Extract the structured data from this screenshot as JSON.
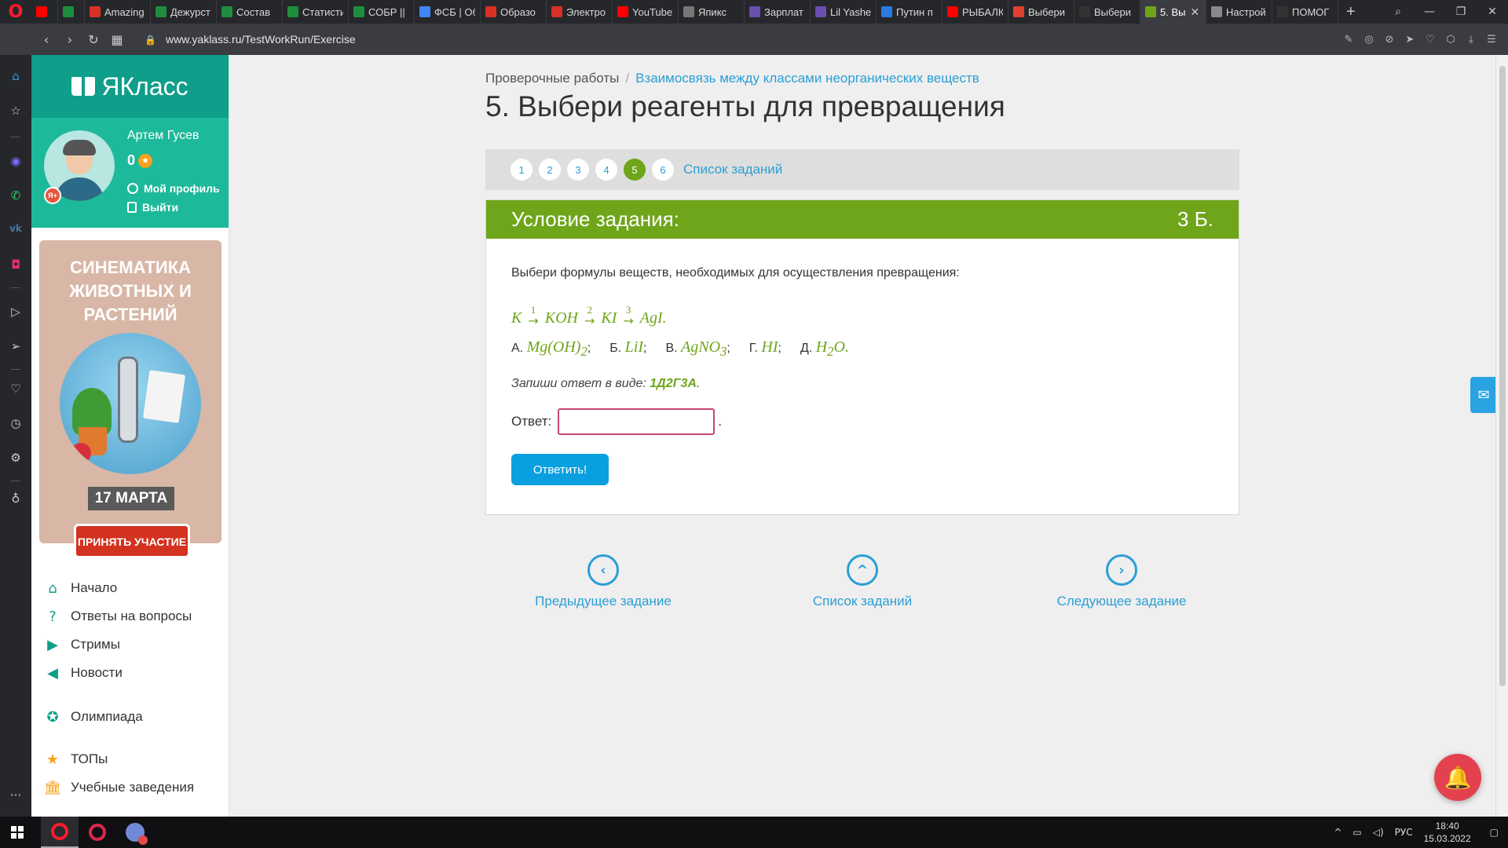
{
  "browser": {
    "tabs": [
      {
        "title": "",
        "color": "#ff0000",
        "icon": "youtube-icon"
      },
      {
        "title": "",
        "color": "#1e8e3e",
        "icon": "sheets-icon"
      },
      {
        "title": "Amazing",
        "color": "#d93025",
        "icon": "adobe-icon"
      },
      {
        "title": "Дежурст",
        "color": "#1e8e3e",
        "icon": "sheets-icon"
      },
      {
        "title": "Состав",
        "color": "#1e8e3e",
        "icon": "sheets-icon"
      },
      {
        "title": "Статисти",
        "color": "#1e8e3e",
        "icon": "sheets-icon"
      },
      {
        "title": "СОБР ||",
        "color": "#1e8e3e",
        "icon": "sheets-icon"
      },
      {
        "title": "ФСБ | Об",
        "color": "#4285f4",
        "icon": "docs-icon"
      },
      {
        "title": "Образо",
        "color": "#d93025",
        "icon": "doc-red-icon"
      },
      {
        "title": "Электро",
        "color": "#d93025",
        "icon": "doc-red-icon"
      },
      {
        "title": "YouTube",
        "color": "#ff0000",
        "icon": "youtube-icon"
      },
      {
        "title": "Япикс",
        "color": "#777777",
        "icon": "yapiks-icon"
      },
      {
        "title": "Зарплат",
        "color": "#6a4fb0",
        "icon": "list-icon"
      },
      {
        "title": "Lil Yasher",
        "color": "#6a4fb0",
        "icon": "list-icon"
      },
      {
        "title": "Путин п",
        "color": "#2a7ae2",
        "icon": "globe-icon"
      },
      {
        "title": "РЫБАЛК",
        "color": "#ff0000",
        "icon": "youtube-icon"
      },
      {
        "title": "Выбери",
        "color": "#e04030",
        "icon": "yandex-icon"
      },
      {
        "title": "Выбери",
        "color": "#333333",
        "icon": "yaklass-icon"
      },
      {
        "title": "5. Вы",
        "color": "#6fa51a",
        "icon": "yaklass-book-icon",
        "active": true
      },
      {
        "title": "Настрой",
        "color": "#888888",
        "icon": "gear-icon"
      },
      {
        "title": "ПОМОГ",
        "color": "#333333",
        "icon": "yaklass-icon"
      }
    ],
    "url": "www.yaklass.ru/TestWorkRun/Exercise"
  },
  "site": {
    "logo": "ЯКласс",
    "user": {
      "name": "Артем Гусев",
      "score": "0",
      "profile_link": "Мой профиль",
      "logout_link": "Выйти"
    },
    "banner": {
      "title": "СИНЕМАТИКА ЖИВОТНЫХ И РАСТЕНИЙ",
      "date": "17 МАРТА",
      "cta": "ПРИНЯТЬ УЧАСТИЕ"
    },
    "menu": [
      {
        "label": "Начало",
        "icon": "home-icon",
        "color": "#0e9e8a"
      },
      {
        "label": "Ответы на вопросы",
        "icon": "question-icon",
        "color": "#0e9e8a"
      },
      {
        "label": "Стримы",
        "icon": "play-icon",
        "color": "#0e9e8a"
      },
      {
        "label": "Новости",
        "icon": "megaphone-icon",
        "color": "#0e9e8a"
      },
      {
        "label": "Олимпиада",
        "icon": "medal-icon",
        "color": "#0e9e8a"
      },
      {
        "label": "ТОПы",
        "icon": "star-icon",
        "color": "#f7a21b"
      },
      {
        "label": "Учебные заведения",
        "icon": "building-icon",
        "color": "#f7a21b"
      }
    ]
  },
  "main": {
    "breadcrumb": {
      "root": "Проверочные работы",
      "current": "Взаимосвязь между классами неорганических веществ"
    },
    "title": "5. Выбери реагенты для превращения",
    "pager": {
      "pages": [
        "1",
        "2",
        "3",
        "4",
        "5",
        "6"
      ],
      "active_index": 4,
      "list_link": "Список заданий"
    },
    "task": {
      "header": "Условие задания:",
      "points": "3 Б.",
      "text": "Выбери формулы веществ, необходимых для осуществления превращения:",
      "chain": {
        "s1": "K",
        "n1": "1",
        "s2": "KOH",
        "n2": "2",
        "s3": "KI",
        "n3": "3",
        "s4": "AgI."
      },
      "options": [
        {
          "letter": "А.",
          "formula": "Mg(OH)",
          "sub": "2",
          "tail": ";"
        },
        {
          "letter": "Б.",
          "formula": "LiI",
          "sub": "",
          "tail": ";"
        },
        {
          "letter": "В.",
          "formula": "AgNO",
          "sub": "3",
          "tail": ";"
        },
        {
          "letter": "Г.",
          "formula": "HI",
          "sub": "",
          "tail": ";"
        },
        {
          "letter": "Д.",
          "formula": "H",
          "sub": "2",
          "tail": "O."
        }
      ],
      "hint_prefix": "Запиши ответ в виде: ",
      "hint_example": "1Д2Г3А",
      "hint_suffix": ".",
      "answer_label": "Ответ:",
      "answer_value": "",
      "answer_suffix": ".",
      "submit_label": "Ответить!"
    },
    "bottom_nav": {
      "prev": "Предыдущее задание",
      "list": "Список заданий",
      "next": "Следующее задание"
    }
  },
  "taskbar": {
    "lang": "РУС",
    "time": "18:40",
    "date": "15.03.2022"
  },
  "colors": {
    "accent_green": "#6fa51a",
    "brand_teal": "#0e9e8a",
    "link_blue": "#2a9fd6"
  }
}
